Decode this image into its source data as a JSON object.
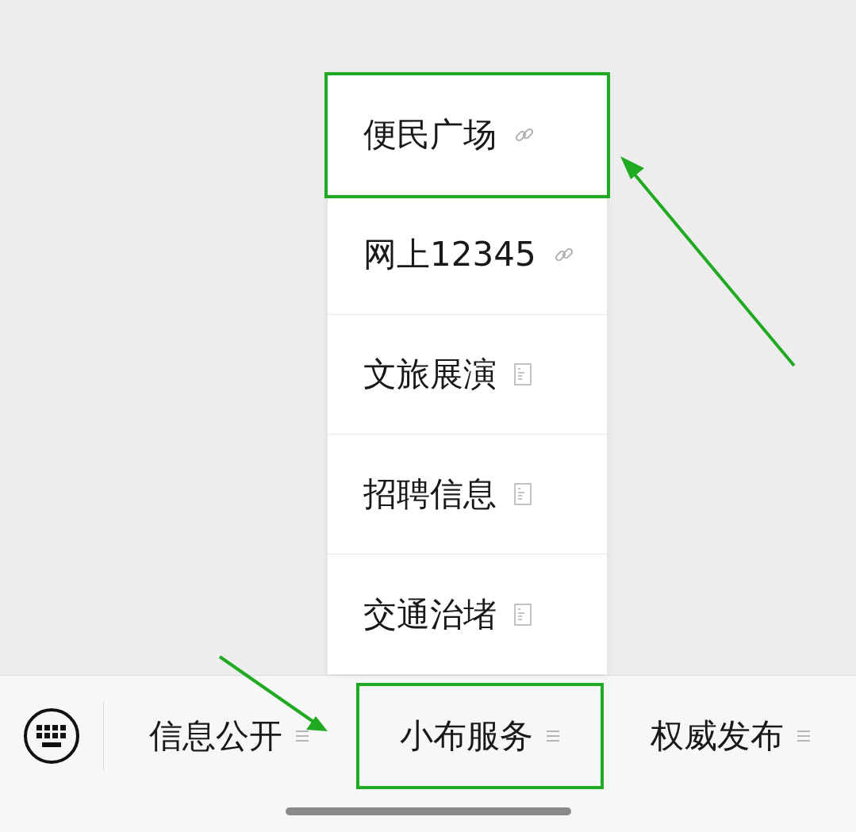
{
  "menu_popup": {
    "items": [
      {
        "label": "便民广场",
        "kind": "link",
        "annotated": true
      },
      {
        "label": "网上12345",
        "kind": "link",
        "annotated": false
      },
      {
        "label": "文旅展演",
        "kind": "page",
        "annotated": false
      },
      {
        "label": "招聘信息",
        "kind": "page",
        "annotated": false
      },
      {
        "label": "交通治堵",
        "kind": "page",
        "annotated": false
      }
    ]
  },
  "bottom_menu": {
    "tabs": [
      {
        "label": "信息公开",
        "annotated": false
      },
      {
        "label": "小布服务",
        "annotated": true
      },
      {
        "label": "权威发布",
        "annotated": false
      }
    ]
  }
}
